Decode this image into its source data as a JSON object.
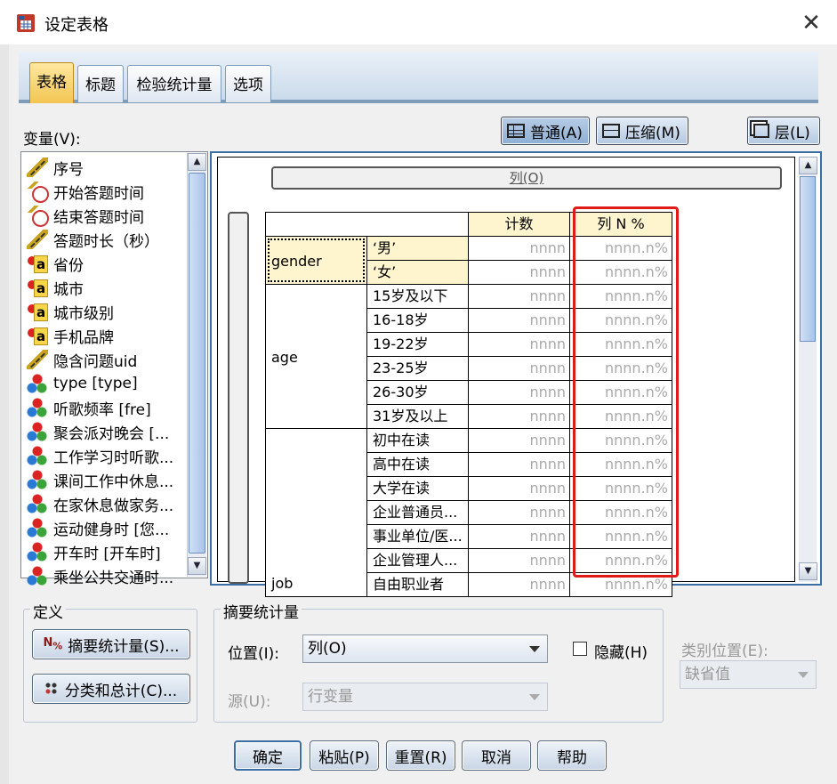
{
  "window": {
    "title": "设定表格"
  },
  "tabs": [
    "表格",
    "标题",
    "检验统计量",
    "选项"
  ],
  "variables_label": "变量(V):",
  "variables": [
    {
      "name": "序号",
      "type": "scale"
    },
    {
      "name": "开始答题时间",
      "type": "date"
    },
    {
      "name": "结束答题时间",
      "type": "date"
    },
    {
      "name": "答题时长（秒）",
      "type": "scale"
    },
    {
      "name": "省份",
      "type": "nominal-string"
    },
    {
      "name": "城市",
      "type": "nominal-string"
    },
    {
      "name": "城市级别",
      "type": "nominal-string"
    },
    {
      "name": "手机品牌",
      "type": "nominal-string"
    },
    {
      "name": "隐含问题uid",
      "type": "scale"
    },
    {
      "name": "type [type]",
      "type": "nominal"
    },
    {
      "name": "听歌频率 [fre]",
      "type": "nominal"
    },
    {
      "name": "聚会派对晚会 [...",
      "type": "nominal"
    },
    {
      "name": "工作学习时听歌...",
      "type": "nominal"
    },
    {
      "name": "课间工作中休息...",
      "type": "nominal"
    },
    {
      "name": "在家休息做家务...",
      "type": "nominal"
    },
    {
      "name": "运动健身时 [您...",
      "type": "nominal"
    },
    {
      "name": "开车时 [开车时]",
      "type": "nominal"
    },
    {
      "name": "乘坐公共交通时...",
      "type": "nominal"
    }
  ],
  "view_buttons": {
    "normal": "普通(A)",
    "compact": "压缩(M)",
    "layers": "层(L)"
  },
  "canvas": {
    "column_drop": "列(O)",
    "headers": {
      "count": "计数",
      "col_pct": "列 N %"
    },
    "groups": [
      {
        "name": "gender",
        "categories": [
          "‘男’",
          "‘女’"
        ]
      },
      {
        "name": "age",
        "categories": [
          "15岁及以下",
          "16-18岁",
          "19-22岁",
          "23-25岁",
          "26-30岁",
          "31岁及以上"
        ]
      },
      {
        "name": "job",
        "categories": [
          "初中在读",
          "高中在读",
          "大学在读",
          "企业普通员...",
          "事业单位/医...",
          "企业管理人...",
          "自由职业者"
        ]
      }
    ],
    "count_placeholder": "nnnn",
    "pct_placeholder": "nnnn.n%"
  },
  "define": {
    "legend": "定义",
    "summary_button": "摘要统计量(S)...",
    "categories_button": "分类和总计(C)..."
  },
  "summary": {
    "legend": "摘要统计量",
    "position_label": "位置(I):",
    "position_value": "列(O)",
    "source_label": "源(U):",
    "source_value": "行变量",
    "hide_label": "隐藏(H)"
  },
  "category_position": {
    "label": "类别位置(E):",
    "value": "缺省值"
  },
  "bottom_buttons": [
    "确定",
    "粘贴(P)",
    "重置(R)",
    "取消",
    "帮助"
  ],
  "colors": {
    "accent_red": "#e01919",
    "header_yellow": "#fef5cf",
    "tab_active": "#f3c553"
  }
}
